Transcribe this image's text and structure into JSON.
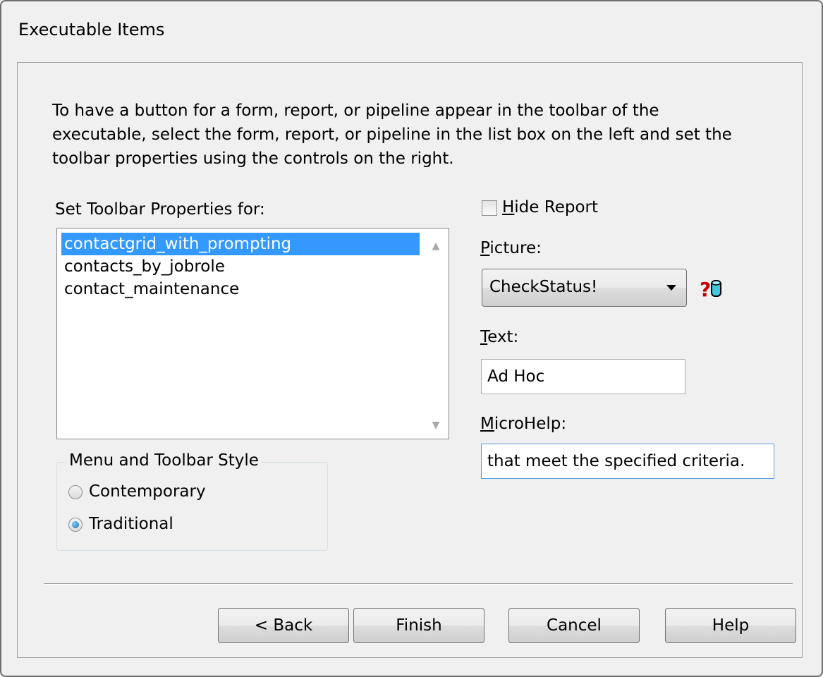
{
  "window": {
    "title": "Executable Items"
  },
  "instructions": "To have a button for a form, report, or pipeline appear in the toolbar of the executable, select the form, report, or pipeline in the list box on the left and set the toolbar properties using the controls on the right.",
  "list": {
    "label": "Set Toolbar Properties for:",
    "items": [
      "contactgrid_with_prompting",
      "contacts_by_jobrole",
      "contact_maintenance"
    ],
    "selected_index": 0
  },
  "style_group": {
    "title": "Menu and Toolbar Style",
    "options": [
      "Contemporary",
      "Traditional"
    ],
    "selected": "Traditional"
  },
  "hide_report": {
    "label_key": "H",
    "label_rest": "ide Report",
    "checked": false
  },
  "picture": {
    "label_key": "P",
    "label_rest": "icture:",
    "value": "CheckStatus!",
    "icon": "help-picture-icon"
  },
  "text_field": {
    "label_key": "T",
    "label_rest": "ext:",
    "value": "Ad Hoc"
  },
  "microhelp": {
    "label_key": "M",
    "label_rest": "icroHelp:",
    "value": "that meet the specified criteria."
  },
  "buttons": {
    "back": "< Back",
    "finish": "Finish",
    "cancel": "Cancel",
    "help": "Help"
  },
  "colors": {
    "selection": "#3399ff",
    "background": "#f0f0f0"
  }
}
